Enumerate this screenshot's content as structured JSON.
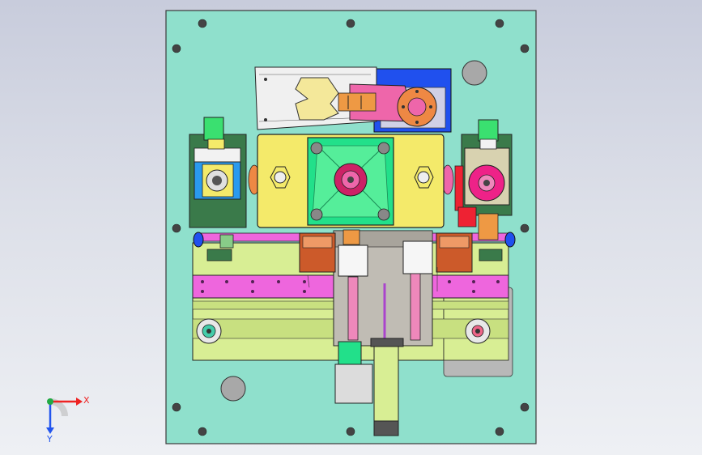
{
  "viewport": {
    "background_top": "#c8ccdc",
    "background_bottom": "#eef0f4"
  },
  "palette": {
    "plate": "#8fe0cc",
    "plate_edge": "#3a3a3a",
    "yellow_block": "#f4ea6a",
    "green_block": "#22e08a",
    "lime_plate": "#d8ee94",
    "magenta_bar": "#ee66dd",
    "blue": "#2050ee",
    "dark_green": "#3a7a4a",
    "gray_carriage": "#c0bcb4",
    "copper": "#cc5a2a",
    "orange": "#ee8844",
    "pink": "#ee66aa",
    "red": "#ee2233",
    "bolt": "#555555"
  },
  "triad": {
    "x_label": "X",
    "y_label": "Y",
    "x_color": "#ee2222",
    "y_color": "#2255ee",
    "origin_color": "#22aa44"
  }
}
